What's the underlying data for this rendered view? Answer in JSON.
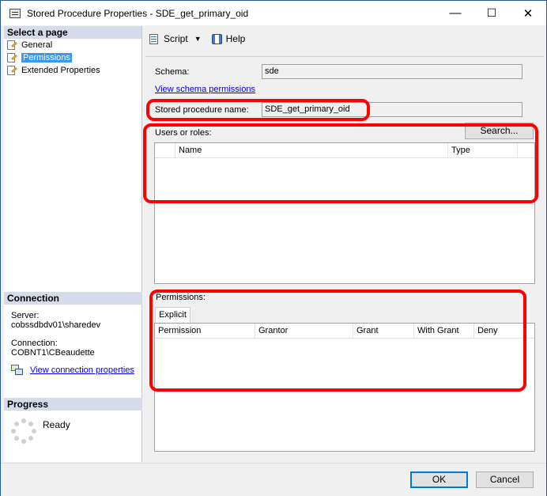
{
  "window": {
    "title": "Stored Procedure Properties - SDE_get_primary_oid",
    "minimize_glyph": "—",
    "maximize_glyph": "☐",
    "close_glyph": "✕"
  },
  "left": {
    "select_page_header": "Select a page",
    "pages": [
      {
        "label": "General",
        "selected": false
      },
      {
        "label": "Permissions",
        "selected": true
      },
      {
        "label": "Extended Properties",
        "selected": false
      }
    ],
    "connection_header": "Connection",
    "server_label": "Server:",
    "server_value": "cobssdbdv01\\sharedev",
    "connection_label": "Connection:",
    "connection_value": "COBNT1\\CBeaudette",
    "view_connection_link": "View connection properties",
    "progress_header": "Progress",
    "progress_status": "Ready"
  },
  "toolbar": {
    "script_label": "Script",
    "help_label": "Help"
  },
  "form": {
    "schema_label": "Schema:",
    "schema_value": "sde",
    "view_schema_link": "View schema permissions",
    "sp_name_label": "Stored procedure name:",
    "sp_name_value": "SDE_get_primary_oid",
    "users_roles_label": "Users or roles:",
    "search_button": "Search...",
    "users_columns": [
      "Name",
      "Type"
    ],
    "permissions_label": "Permissions:",
    "tab_explicit": "Explicit",
    "perm_columns": [
      "Permission",
      "Grantor",
      "Grant",
      "With Grant",
      "Deny"
    ]
  },
  "buttons": {
    "ok": "OK",
    "cancel": "Cancel"
  },
  "colors": {
    "highlight": "#ff0000",
    "selected_item": "#3399ff",
    "link": "#0000ee",
    "panel_header": "#d6dbe9"
  },
  "icons": [
    "app-icon",
    "properties-page-icon",
    "connection-icon",
    "script-icon",
    "help-icon",
    "dropdown-arrow-icon",
    "progress-spinner-icon"
  ]
}
